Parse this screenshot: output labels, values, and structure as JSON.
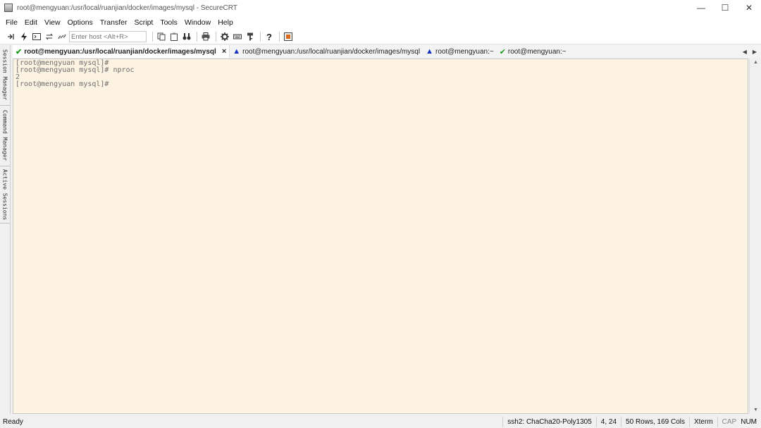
{
  "window": {
    "title": "root@mengyuan:/usr/local/ruanjian/docker/images/mysql - SecureCRT",
    "minimize": "—",
    "maximize": "☐",
    "close": "✕"
  },
  "menu": [
    "File",
    "Edit",
    "View",
    "Options",
    "Transfer",
    "Script",
    "Tools",
    "Window",
    "Help"
  ],
  "toolbar": {
    "host_placeholder": "Enter host <Alt+R>",
    "icons": [
      "connect-icon",
      "quick-connect-icon",
      "terminal-icon",
      "reconnect-icon",
      "disconnect-icon",
      "copy-icon",
      "paste-icon",
      "find-icon",
      "print-icon",
      "settings-icon",
      "keymap-icon",
      "key-icon",
      "help-icon",
      "sftp-icon"
    ]
  },
  "tabs": [
    {
      "label": "root@mengyuan:/usr/local/ruanjian/docker/images/mysql",
      "status": "connected",
      "active": true,
      "close": "×"
    },
    {
      "label": "root@mengyuan:/usr/local/ruanjian/docker/images/mysql",
      "status": "warning",
      "active": false
    },
    {
      "label": "root@mengyuan:~",
      "status": "warning",
      "active": false
    },
    {
      "label": "root@mengyuan:~",
      "status": "connected",
      "active": false
    }
  ],
  "tab_scroll": {
    "left": "◀",
    "right": "▶"
  },
  "sidebar": {
    "session_manager": "Session Manager",
    "command_manager": "Command Manager",
    "active_sessions": "Active Sessions"
  },
  "terminal": {
    "lines": [
      "[root@mengyuan mysql]#",
      "[root@mengyuan mysql]# nproc",
      "2",
      "[root@mengyuan mysql]#"
    ]
  },
  "status": {
    "ready": "Ready",
    "cipher": "ssh2: ChaCha20-Poly1305",
    "cursor": "4,  24",
    "size": "50 Rows, 169 Cols",
    "term": "Xterm",
    "cap": "CAP",
    "num": "NUM"
  },
  "colors": {
    "terminal_bg": "#fdf3e3",
    "terminal_text": "#6e6e6e",
    "connected": "#1a9c1a",
    "warning": "#1030c0"
  }
}
